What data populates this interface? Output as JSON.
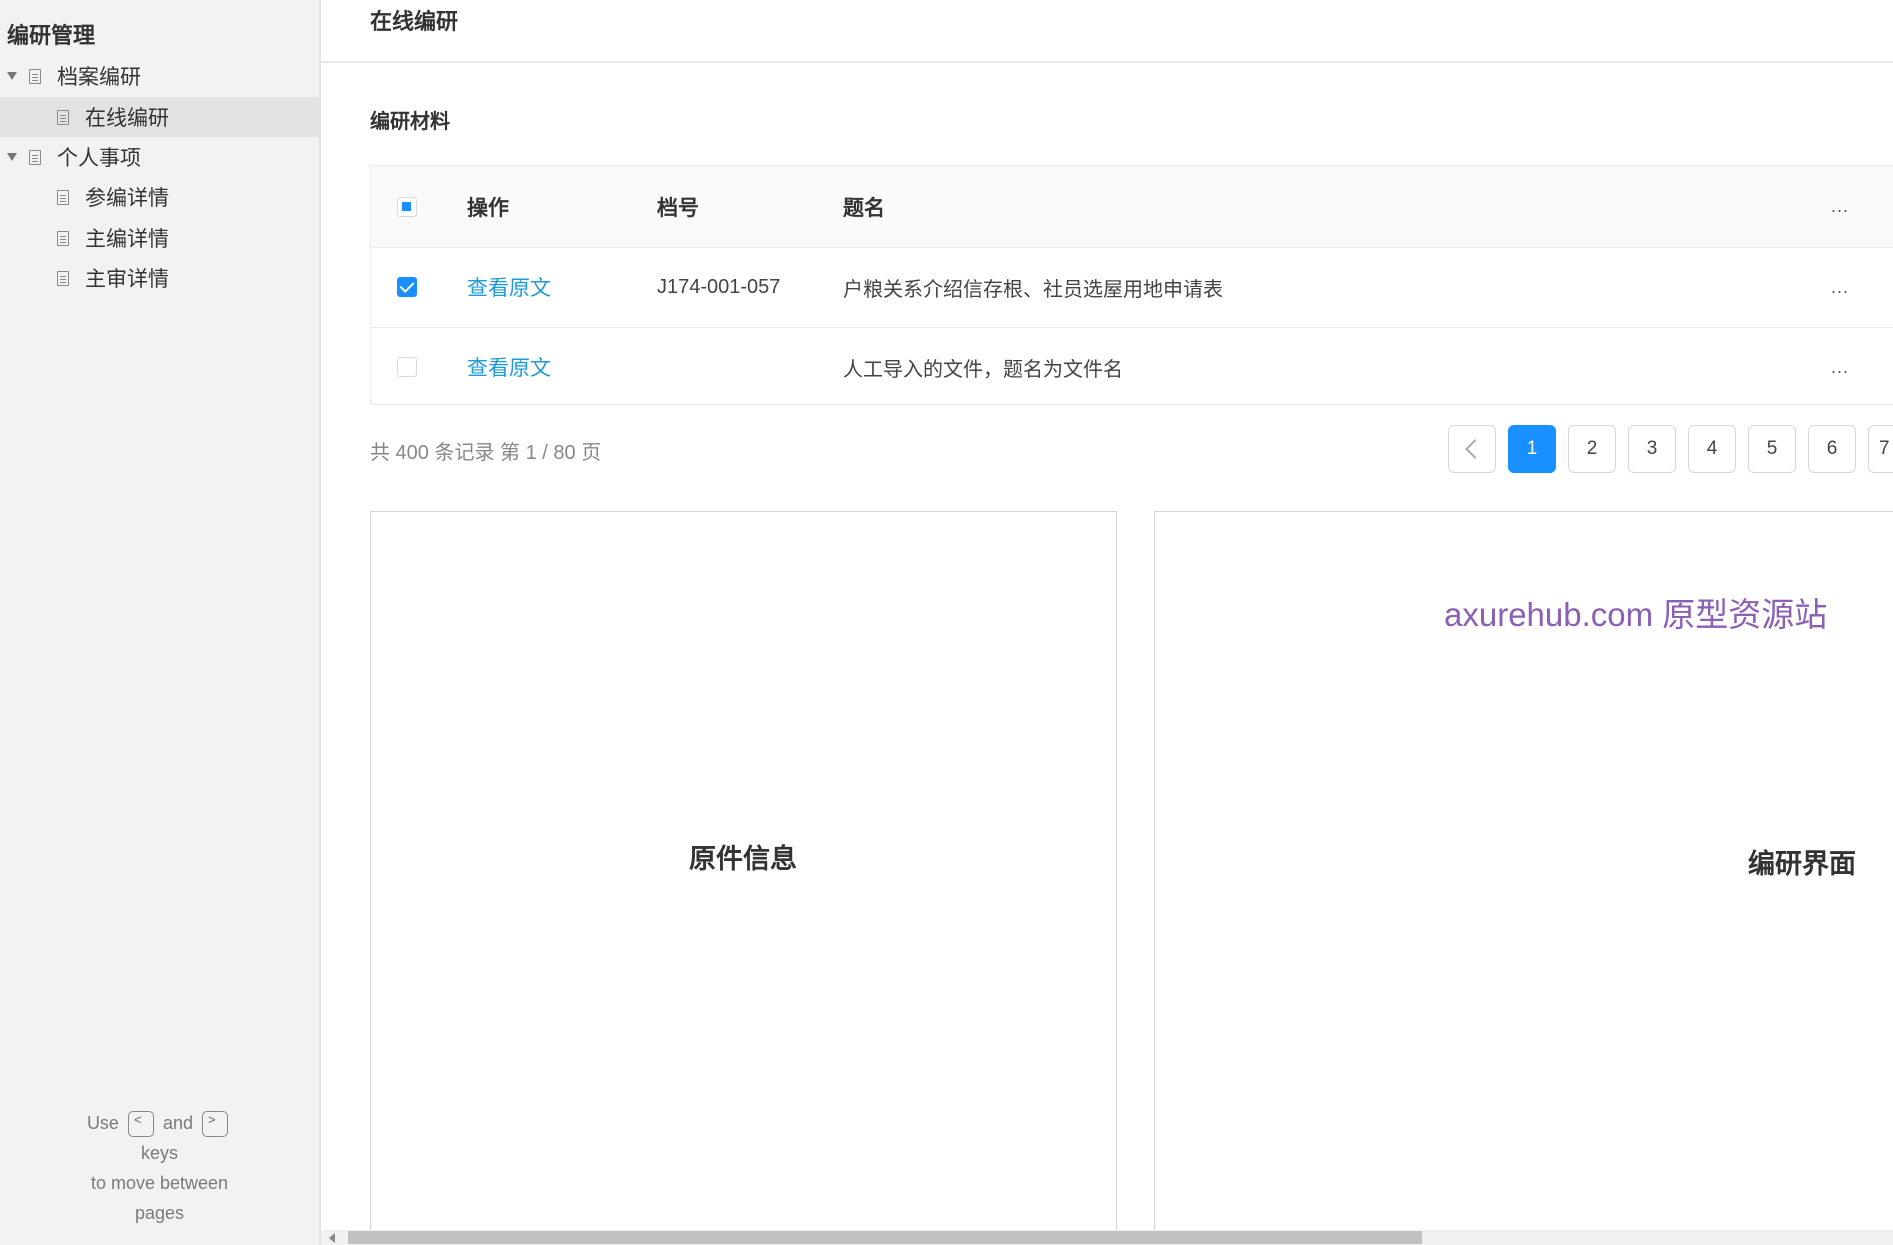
{
  "sidebar": {
    "title": "编研管理",
    "tree": [
      {
        "label": "档案编研"
      },
      {
        "label": "在线编研"
      },
      {
        "label": "个人事项"
      },
      {
        "label": "参编详情"
      },
      {
        "label": "主编详情"
      },
      {
        "label": "主审详情"
      }
    ],
    "help": {
      "use": "Use",
      "key_prev": "<",
      "and": "and",
      "key_next": ">",
      "keys": "keys",
      "line2": "to move between",
      "line3": "pages"
    }
  },
  "header": {
    "title": "在线编研"
  },
  "section": {
    "title": "编研材料"
  },
  "table": {
    "columns": {
      "op": "操作",
      "code": "档号",
      "title": "题名",
      "more": "..."
    },
    "rows": [
      {
        "op": "查看原文",
        "code": "J174-001-057",
        "title": "户粮关系介绍信存根、社员选屋用地申请表",
        "more": "...",
        "checked": true
      },
      {
        "op": "查看原文",
        "code": "",
        "title": "人工导入的文件，题名为文件名",
        "more": "...",
        "checked": false
      }
    ]
  },
  "pagination": {
    "summary": "共 400 条记录 第 1 / 80 页",
    "pages": [
      "1",
      "2",
      "3",
      "4",
      "5",
      "6",
      "7"
    ],
    "current": "1"
  },
  "panels": {
    "left_label": "原件信息",
    "right_label": "编研界面",
    "watermark": "axurehub.com 原型资源站"
  },
  "colors": {
    "accent": "#1890ff",
    "link": "#1e9bd6",
    "watermark": "#8a5fb5"
  }
}
